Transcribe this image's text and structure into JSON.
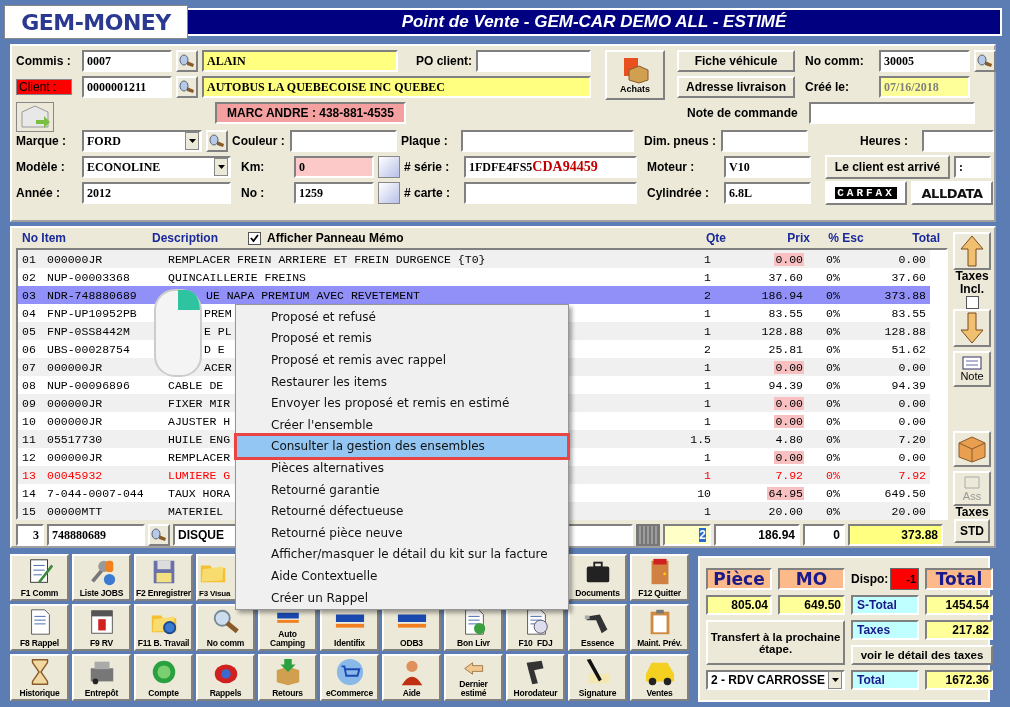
{
  "header": {
    "logo": "GEM-MONEY",
    "title": "Point de Vente - GEM-CAR DEMO ALL  - ESTIMÉ"
  },
  "form": {
    "commis_label": "Commis :",
    "commis_code": "0007",
    "commis_name": "ALAIN",
    "po_label": "PO client:",
    "client_label": "Client :",
    "client_code": "0000001211",
    "client_name": "AUTOBUS LA QUEBECOISE INC QUEBEC",
    "contact": "MARC ANDRE : 438-881-4535",
    "achats_button": "Achats",
    "fiche_button": "Fiche véhicule",
    "adresse_button": "Adresse livraison",
    "no_comm_label": "No comm:",
    "no_comm": "30005",
    "cree_label": "Créé le:",
    "cree": "07/16/2018",
    "note_label": "Note de commande",
    "marque_label": "Marque :",
    "marque": "FORD",
    "couleur_label": "Couleur :",
    "plaque_label": "Plaque :",
    "dim_label": "Dim. pneus :",
    "heures_label": "Heures :",
    "modele_label": "Modèle :",
    "modele": "ECONOLINE",
    "km_label": "Km:",
    "km": "0",
    "serie_label": "# série :",
    "serie": {
      "plain": "1FDFE4FS5",
      "highlight": "CDA94459"
    },
    "moteur_label": "Moteur :",
    "moteur": "V10",
    "arrive_button": "Le client est arrivé",
    "arrive_value": ":",
    "annee_label": "Année :",
    "annee": "2012",
    "no_label": "No :",
    "no": "1259",
    "carte_label": "# carte :",
    "cylindree_label": "Cylindrée :",
    "cylindree": "6.8L",
    "carfax": "CARFAX",
    "alldata": "ALLDATA"
  },
  "table": {
    "columns": [
      "No Item",
      "Description",
      "Qte",
      "Prix",
      "% Esc",
      "Total"
    ],
    "memo": {
      "label": "Afficher Panneau Mémo",
      "checked": true
    },
    "rows": [
      {
        "no": "01",
        "item": "000000JR",
        "description": "REMPLACER FREIN ARRIERE ET FREIN DURGENCE  {T0}",
        "qty": "1",
        "price": "0.00",
        "discount": "0%",
        "total": "0.00",
        "selected": false,
        "price_flagged": true,
        "alert": false
      },
      {
        "no": "02",
        "item": "NUP-00003368",
        "description": "QUINCAILLERIE FREINS",
        "qty": "1",
        "price": "37.60",
        "discount": "0%",
        "total": "37.60",
        "selected": false,
        "price_flagged": false,
        "alert": false
      },
      {
        "no": "03",
        "item": "NDR-748880689",
        "description": "UE NAPA PREMIUM AVEC REVETEMENT",
        "qty": "2",
        "price": "186.94",
        "discount": "0%",
        "total": "373.88",
        "selected": true,
        "price_flagged": false,
        "alert": false
      },
      {
        "no": "04",
        "item": "FNP-UP10952PB",
        "description": "PREM",
        "qty": "1",
        "price": "83.55",
        "discount": "0%",
        "total": "83.55",
        "selected": false,
        "price_flagged": false,
        "alert": false
      },
      {
        "no": "05",
        "item": "FNP-0SS8442M",
        "description": "E PL",
        "qty": "1",
        "price": "128.88",
        "discount": "0%",
        "total": "128.88",
        "selected": false,
        "price_flagged": false,
        "alert": false
      },
      {
        "no": "06",
        "item": "UBS-00028754",
        "description": "D E",
        "qty": "2",
        "price": "25.81",
        "discount": "0%",
        "total": "51.62",
        "selected": false,
        "price_flagged": false,
        "alert": false
      },
      {
        "no": "07",
        "item": "000000JR",
        "description": "ACER",
        "qty": "1",
        "price": "0.00",
        "discount": "0%",
        "total": "0.00",
        "selected": false,
        "price_flagged": true,
        "alert": false
      },
      {
        "no": "08",
        "item": "NUP-00096896",
        "description": "CABLE DE",
        "qty": "1",
        "price": "94.39",
        "discount": "0%",
        "total": "94.39",
        "selected": false,
        "price_flagged": false,
        "alert": false
      },
      {
        "no": "09",
        "item": "000000JR",
        "description": "FIXER MIR",
        "qty": "1",
        "price": "0.00",
        "discount": "0%",
        "total": "0.00",
        "selected": false,
        "price_flagged": true,
        "alert": false
      },
      {
        "no": "10",
        "item": "000000JR",
        "description": "AJUSTER H",
        "qty": "1",
        "price": "0.00",
        "discount": "0%",
        "total": "0.00",
        "selected": false,
        "price_flagged": true,
        "alert": false
      },
      {
        "no": "11",
        "item": "05517730",
        "description": "HUILE ENG",
        "qty": "1.5",
        "price": "4.80",
        "discount": "0%",
        "total": "7.20",
        "selected": false,
        "price_flagged": false,
        "alert": false
      },
      {
        "no": "12",
        "item": "000000JR",
        "description": "REMPLACER",
        "qty": "1",
        "price": "0.00",
        "discount": "0%",
        "total": "0.00",
        "selected": false,
        "price_flagged": true,
        "alert": false
      },
      {
        "no": "13",
        "item": "00045932",
        "description": "LUMIERE G",
        "qty": "1",
        "price": "7.92",
        "discount": "0%",
        "total": "7.92",
        "selected": false,
        "price_flagged": false,
        "alert": true
      },
      {
        "no": "14",
        "item": "7-044-0007-044",
        "description": "TAUX HORA",
        "qty": "10",
        "price": "64.95",
        "discount": "0%",
        "total": "649.50",
        "selected": false,
        "price_flagged": true,
        "alert": false
      },
      {
        "no": "15",
        "item": "00000MTT",
        "description": "MATERIEL",
        "qty": "1",
        "price": "20.00",
        "discount": "0%",
        "total": "20.00",
        "selected": false,
        "price_flagged": false,
        "alert": false
      }
    ],
    "entry": {
      "line": "3",
      "item": "748880689",
      "description": "DISQUE",
      "qty": "2",
      "price": "186.94",
      "discount": "0",
      "total": "373.88"
    }
  },
  "side": {
    "taxes_incl": {
      "label": "Taxes Incl.",
      "checked": false
    },
    "note_button": "Note",
    "ass_button": {
      "label": "Ass",
      "disabled": true
    },
    "taxes_label": "Taxes",
    "std_button": "STD"
  },
  "context_menu": [
    {
      "label": "Proposé et refusé",
      "selected": false
    },
    {
      "label": "Proposé et remis",
      "selected": false
    },
    {
      "label": "Proposé et remis avec rappel",
      "selected": false
    },
    {
      "label": "Restaurer les items",
      "selected": false
    },
    {
      "label": "Envoyer les proposé et remis en estimé",
      "selected": false
    },
    {
      "label": "Créer l'ensemble",
      "selected": false
    },
    {
      "label": "Consulter la gestion des ensembles",
      "selected": true
    },
    {
      "label": "Pièces alternatives",
      "selected": false
    },
    {
      "label": "Retourné garantie",
      "selected": false
    },
    {
      "label": "Retourné défectueuse",
      "selected": false
    },
    {
      "label": "Retourné pièce neuve",
      "selected": false
    },
    {
      "label": "Afficher/masquer le détail du kit sur la facture",
      "selected": false
    },
    {
      "label": "Aide Contextuelle",
      "selected": false
    },
    {
      "label": "Créer un Rappel",
      "selected": false
    }
  ],
  "toolbar": [
    [
      {
        "label": "F1 Comm"
      },
      {
        "label": "Liste JOBS"
      },
      {
        "label": "F2 Enregistrer"
      },
      {
        "label": "F3 Visua",
        "cut": true
      },
      {
        "label": "Documents"
      },
      {
        "label": "F12 Quitter"
      }
    ],
    [
      {
        "label": "F8 Rappel"
      },
      {
        "label": "F9 RV"
      },
      {
        "label": "F11 B. Travail"
      },
      {
        "label": "No comm"
      },
      {
        "label": "Auto\nCamping"
      },
      {
        "label": "Identifix"
      },
      {
        "label": "ODB3"
      },
      {
        "label": "Bon Livr"
      },
      {
        "label": "F10  FDJ"
      },
      {
        "label": "Essence"
      },
      {
        "label": "Maint. Prév."
      }
    ],
    [
      {
        "label": "Historique"
      },
      {
        "label": "Entrepôt"
      },
      {
        "label": "Compte"
      },
      {
        "label": "Rappels"
      },
      {
        "label": "Retours"
      },
      {
        "label": "eCommerce"
      },
      {
        "label": "Aide"
      },
      {
        "label": "Dernier\nestimé"
      },
      {
        "label": "Horodateur"
      },
      {
        "label": "Signature"
      },
      {
        "label": "Ventes"
      }
    ]
  ],
  "totals": {
    "piece_label": "Pièce",
    "mo_label": "MO",
    "dispo_label": "Dispo:",
    "dispo": "-1",
    "total_label": "Total",
    "piece": "805.04",
    "mo": "649.50",
    "s_total_label": "S-Total",
    "s_total": "1454.54",
    "taxes_label": "Taxes",
    "taxes": "217.82",
    "transfer_button": "Transfert à la prochaine étape.",
    "stage": "2 - RDV CARROSSE",
    "details_button": "voir le détail des taxes",
    "grand_total_label": "Total",
    "grand_total": "1672.36"
  }
}
